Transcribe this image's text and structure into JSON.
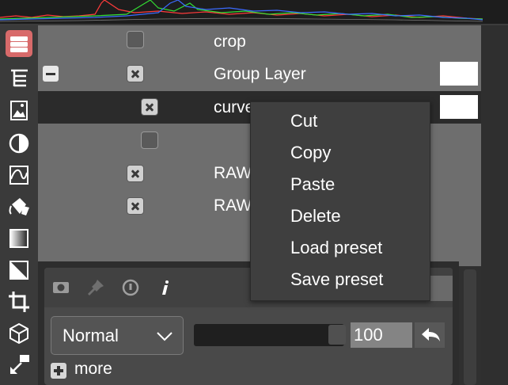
{
  "colors": {
    "accent": "#d86a6a",
    "background": "#6e6e6e",
    "selected_row": "#2b2b2b",
    "menu_background": "#3f3f3f",
    "histogram_red": "#ff3b3b",
    "histogram_green": "#33dd33",
    "histogram_blue": "#3b6bff"
  },
  "histogram": {
    "icon": "histogram"
  },
  "toolbar": {
    "tools": [
      {
        "name": "layers-icon",
        "active": true
      },
      {
        "name": "layer-tree-icon",
        "active": false
      },
      {
        "name": "image-icon",
        "active": false
      },
      {
        "name": "contrast-icon",
        "active": false
      },
      {
        "name": "curve-icon",
        "active": false
      },
      {
        "name": "paint-bucket-icon",
        "active": false
      },
      {
        "name": "gradient-icon",
        "active": false
      },
      {
        "name": "diagonal-icon",
        "active": false
      },
      {
        "name": "crop-icon",
        "active": false
      },
      {
        "name": "cube-icon",
        "active": false
      },
      {
        "name": "resize-icon",
        "active": false
      }
    ]
  },
  "layers": [
    {
      "label": "crop",
      "visible": false
    },
    {
      "label": "Group Layer",
      "visible": true,
      "expanded": true
    },
    {
      "label": "curves",
      "visible": true,
      "selected": true
    },
    {
      "label": "",
      "visible": false
    },
    {
      "label": "RAW",
      "visible": true
    },
    {
      "label": "RAW",
      "visible": true
    }
  ],
  "context_menu": {
    "items": [
      "Cut",
      "Copy",
      "Paste",
      "Delete",
      "Load preset",
      "Save preset"
    ]
  },
  "bottom_panel": {
    "icons": [
      "mask-icon",
      "pin-icon",
      "info-circle-icon",
      "info-icon"
    ],
    "blend_mode": "Normal",
    "opacity": 100,
    "opacity_text": "100",
    "more_label": "more"
  }
}
